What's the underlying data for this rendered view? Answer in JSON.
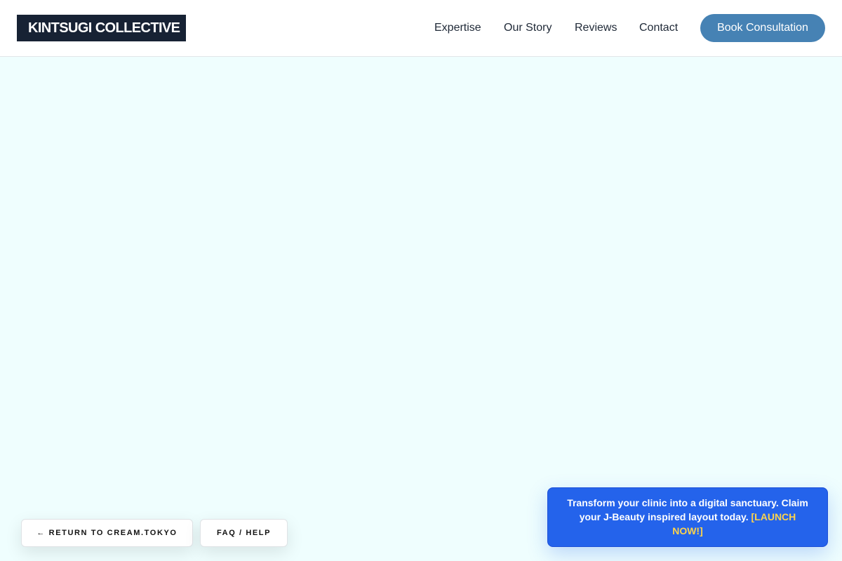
{
  "brand": {
    "name": "KINTSUGI COLLECTIVE"
  },
  "nav": {
    "items": [
      {
        "label": "Expertise"
      },
      {
        "label": "Our Story"
      },
      {
        "label": "Reviews"
      },
      {
        "label": "Contact"
      }
    ],
    "cta_label": "Book Consultation"
  },
  "footer_chips": {
    "return_label": "← RETURN TO CREAM.TOKYO",
    "faq_label": "FAQ / HELP"
  },
  "promo": {
    "text": "Transform your clinic into a digital sanctuary. Claim your J-Beauty inspired layout today.",
    "link_label": "[LAUNCH NOW!]"
  },
  "colors": {
    "page_background": "#effefe",
    "header_background": "#ffffff",
    "logo_background": "#172234",
    "cta_background": "#4682b4",
    "promo_background": "#2463eb",
    "promo_link": "#fcd34d"
  }
}
